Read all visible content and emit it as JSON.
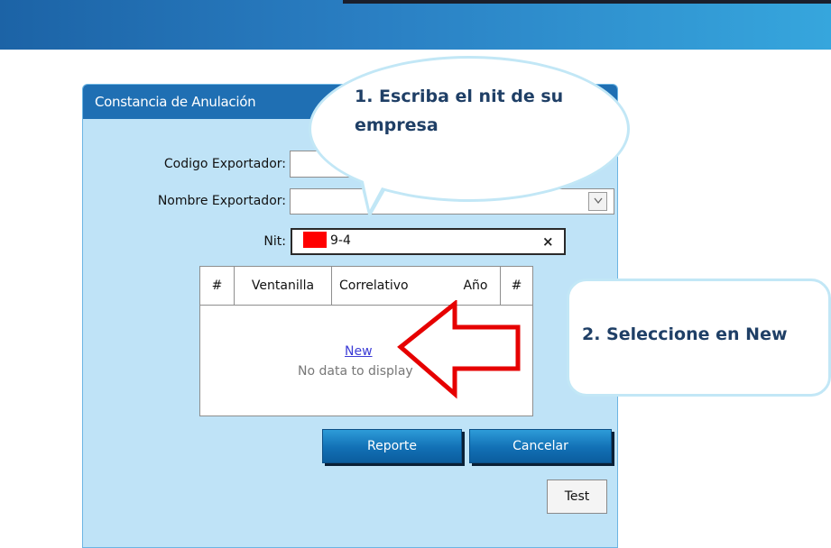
{
  "dialog": {
    "title": "Constancia de Anulación"
  },
  "form": {
    "codigo_label": "Codigo Exportador:",
    "codigo_value": "",
    "nombre_label": "Nombre Exportador:",
    "nombre_value": "",
    "nit_label": "Nit:",
    "nit_value": "9-4",
    "clear_glyph": "×"
  },
  "grid": {
    "columns": [
      "#",
      "Ventanilla",
      "Correlativo",
      "Año",
      "#"
    ],
    "new_link": "New",
    "empty_text": "No data to display"
  },
  "buttons": {
    "reporte": "Reporte",
    "cancelar": "Cancelar",
    "test": "Test"
  },
  "callouts": {
    "step1": "1. Escriba el nit de su empresa",
    "step2": "2. Seleccione en New"
  },
  "colors": {
    "banner": "#1c63a6",
    "dialog_header": "#1f6fb3",
    "dialog_body": "#bfe3f7",
    "arrow": "#e60000",
    "redaction": "#ff0000"
  },
  "icons": {
    "dropdown": "chevron-down-icon",
    "clear": "close-icon",
    "arrow": "left-arrow-icon"
  }
}
